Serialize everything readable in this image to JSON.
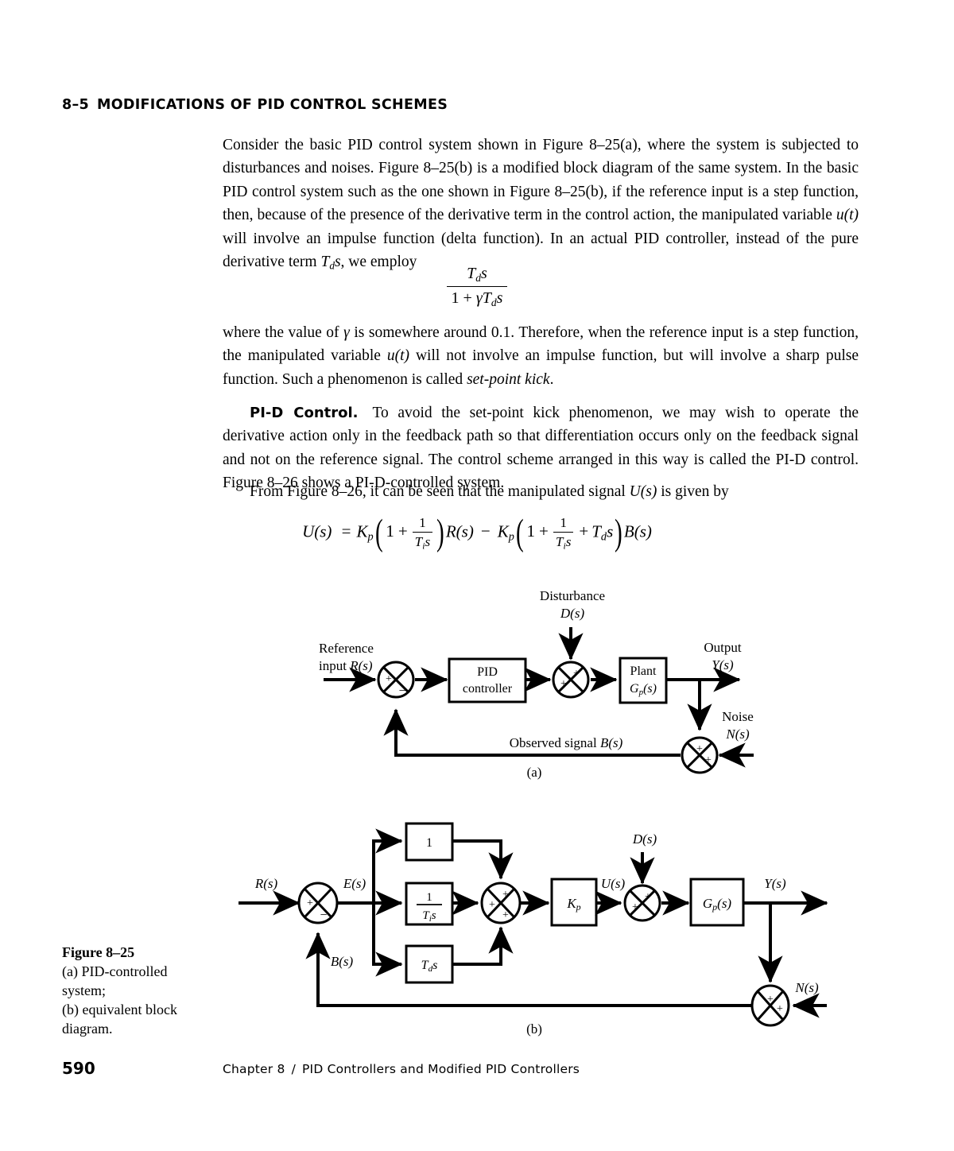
{
  "section": {
    "number": "8–5",
    "title": "MODIFICATIONS OF PID CONTROL SCHEMES"
  },
  "paragraphs": {
    "p1_a": "Consider the basic PID control system shown in Figure 8–25(a), where the system is subjected to disturbances and noises. Figure 8–25(b) is a modified block diagram of the same system. In the basic PID control system such as the one shown in Figure 8–25(b), if the reference input is a step function, then, because of the presence of the derivative term in the control action, the manipulated variable ",
    "p1_u": "u(t)",
    "p1_b": " will involve an impulse function (delta function). In an actual PID controller, instead of the pure derivative term ",
    "p1_Td": "T",
    "p1_Td_sub": "d",
    "p1_Td_s": "s",
    "p1_c": ", we employ",
    "p2_a": "where the value of ",
    "p2_gamma": "γ",
    "p2_b": " is somewhere around 0.1. Therefore, when the reference input is a step function, the manipulated variable ",
    "p2_u": "u(t)",
    "p2_c": " will not involve an impulse function, but will involve a sharp pulse function. Such a phenomenon is called ",
    "p2_italic": "set-point kick",
    "p2_d": ".",
    "p3_head": "PI-D Control.",
    "p3_body": "To avoid the set-point kick phenomenon, we may wish to operate the derivative action only in the feedback path so that differentiation occurs only on the feedback signal and not on the reference signal. The control scheme arranged in this way is called the PI-D control. Figure 8–26 shows a PI-D-controlled system.",
    "p4_a": "From Figure 8–26, it can be seen that the manipulated signal ",
    "p4_U": "U(s)",
    "p4_b": " is given by"
  },
  "equations": {
    "frac_numerator": "T",
    "frac_numerator_sub": "d",
    "frac_numerator_s": "s",
    "frac_denominator_1": "1 + ",
    "frac_denominator_gamma": "γT",
    "frac_denominator_sub": "d",
    "frac_denominator_s": "s",
    "main": {
      "lhs": "U(s)",
      "eq": "=",
      "Kp": "K",
      "Kp_sub": "p",
      "one": "1",
      "plus": "+",
      "minus": "−",
      "frac_top": "1",
      "frac_bot_T": "T",
      "frac_bot_sub": "i",
      "frac_bot_s": "s",
      "Rs": "R(s)",
      "Td": "T",
      "Td_sub": "d",
      "Td_s": "s",
      "Bs": "B(s)"
    }
  },
  "figure_a": {
    "panel_label": "(a)",
    "labels": {
      "disturbance_title": "Disturbance",
      "disturbance_sym": "D(s)",
      "reference_title": "Reference",
      "reference_sym": "input R(s)",
      "output_title": "Output",
      "output_sym": "Y(s)",
      "noise_title": "Noise",
      "noise_sym": "N(s)",
      "feedback": "Observed signal B(s)"
    },
    "blocks": [
      {
        "name": "pid-controller",
        "line1": "PID",
        "line2": "controller"
      },
      {
        "name": "plant",
        "line1": "Plant",
        "line2": "G",
        "line2_sub": "p",
        "line2_tail": "(s)"
      }
    ],
    "summing_junctions": [
      {
        "name": "error-junction",
        "signs": {
          "left": "+",
          "bottom": "−"
        }
      },
      {
        "name": "disturbance-junction",
        "signs": {
          "top": "+",
          "left": "+"
        }
      },
      {
        "name": "noise-junction",
        "signs": {
          "top": "+",
          "right": "+"
        }
      }
    ]
  },
  "figure_b": {
    "panel_label": "(b)",
    "labels": {
      "Rs": "R(s)",
      "Es": "E(s)",
      "Bs": "B(s)",
      "Us": "U(s)",
      "Ds": "D(s)",
      "Ys": "Y(s)",
      "Ns": "N(s)"
    },
    "blocks": [
      {
        "name": "proportional-block",
        "text": "1"
      },
      {
        "name": "integral-block",
        "num": "1",
        "den_T": "T",
        "den_sub": "i",
        "den_s": "s"
      },
      {
        "name": "derivative-block",
        "T": "T",
        "sub": "d",
        "s": "s"
      },
      {
        "name": "gain-block",
        "K": "K",
        "sub": "p"
      },
      {
        "name": "plant-block",
        "G": "G",
        "sub": "p",
        "tail": "(s)"
      }
    ],
    "summing_junctions": [
      {
        "name": "error-junction",
        "signs": {
          "left": "+",
          "bottom": "−"
        }
      },
      {
        "name": "pid-sum-junction",
        "signs": {
          "top": "+",
          "left": "+",
          "bottom": "+"
        }
      },
      {
        "name": "disturbance-junction",
        "signs": {
          "top": "+",
          "left": "+"
        }
      },
      {
        "name": "noise-junction",
        "signs": {
          "top": "+",
          "right": "+"
        }
      }
    ]
  },
  "caption": {
    "title": "Figure 8–25",
    "line1": "(a) PID-controlled",
    "line2": "system;",
    "line3": "(b) equivalent block",
    "line4": "diagram."
  },
  "footer": {
    "page_number": "590",
    "chapter": "Chapter 8",
    "separator": "/",
    "chapter_title": "PID Controllers and Modified PID Controllers"
  },
  "colors": {
    "ink": "#000000",
    "page": "#ffffff"
  }
}
